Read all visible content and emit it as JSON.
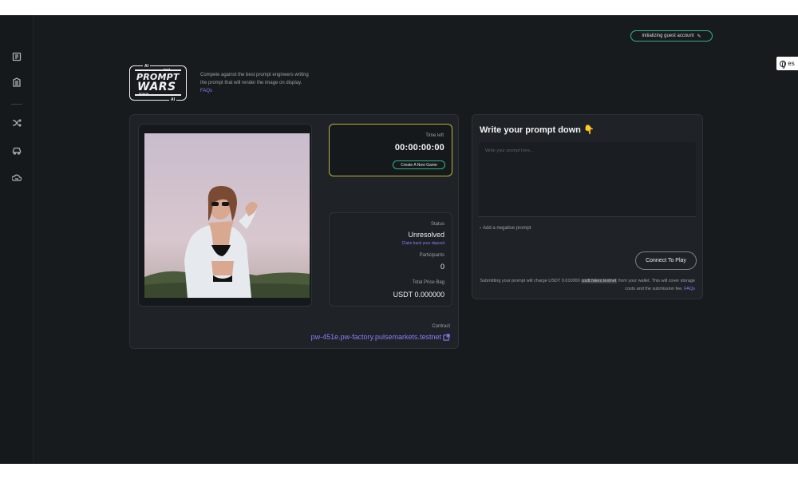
{
  "header": {
    "guest_account": "initializing guest account",
    "language": "es"
  },
  "sidebar": {
    "items": [
      {
        "icon": "book-icon"
      },
      {
        "icon": "building-icon"
      },
      {
        "icon": "shuffle-icon"
      },
      {
        "icon": "car-icon"
      },
      {
        "icon": "cloud-car-icon"
      }
    ]
  },
  "logo": {
    "ai_top": "AI",
    "test": "test",
    "line1": "PROMPT",
    "line2": "WARS",
    "image": "image",
    "ai_bottom": "AI"
  },
  "tagline": {
    "text": "Compete against the best prompt engineers writing the prompt that will render the image on display.",
    "faq": "FAQs"
  },
  "game": {
    "time_left_label": "Time left",
    "time_left": "00:00:00:00",
    "new_game_button": "Create A New Game",
    "status_label": "Status",
    "status_value": "Unresolved",
    "claim_link": "Claim back your deposit",
    "participants_label": "Participants",
    "participants_value": "0",
    "price_bag_label": "Total Price Bag",
    "price_bag_value": "USDT 0.000000",
    "contract_label": "Contract",
    "contract_value": "pw-451e.pw-factory.pulsemarkets.testnet"
  },
  "prompt": {
    "title": "Write your prompt down 👇",
    "placeholder": "Write your prompt here...",
    "negative_toggle": "Add a negative prompt",
    "connect_button": "Connect To Play",
    "note_prefix": "Submitting your prompt will charge USDT 0.010000",
    "note_highlight": "usdt.fakes.testnet",
    "note_suffix": "from your wallet. This will cover storage costs and the submission fee.",
    "note_faq": "FAQs"
  }
}
